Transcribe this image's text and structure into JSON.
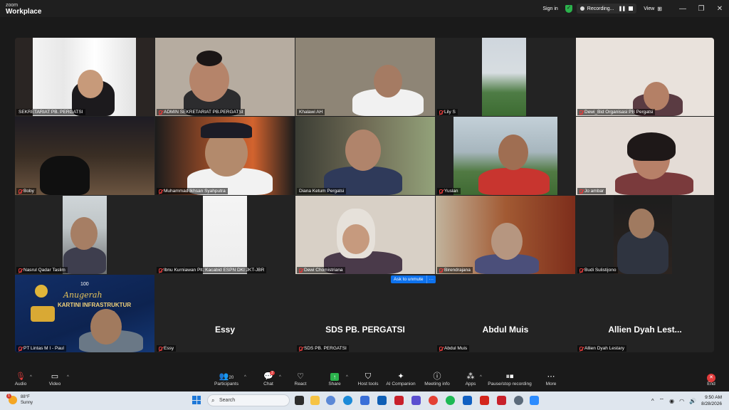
{
  "window": {
    "logo_top": "zoom",
    "logo_bottom": "Workplace",
    "sign_in": "Sign in",
    "recording_label": "Recording...",
    "view_label": "View"
  },
  "participants": [
    {
      "name": "SEKRETARIAT PB. PERGATSI",
      "muted": false
    },
    {
      "name": "ADMIN SEKRETARIAT PB.PERGATSI",
      "muted": true
    },
    {
      "name": "Khalawi AH",
      "muted": false
    },
    {
      "name": "Lily S",
      "muted": true
    },
    {
      "name": "Dewi_Bid Organisasi PB Pergatsi",
      "muted": true
    },
    {
      "name": "Boby",
      "muted": true
    },
    {
      "name": "Muhammad Ikhsan Syahputra",
      "muted": true
    },
    {
      "name": "Diana Ketum Pergatsi",
      "muted": false
    },
    {
      "name": "Yuslan",
      "muted": true
    },
    {
      "name": "Jo ambar",
      "muted": true
    },
    {
      "name": "Nasrul Qadar Taslim",
      "muted": true
    },
    {
      "name": "Ibnu Kurniawan Plt. Kacabid ESPN DKI JKT-JBR",
      "muted": true
    },
    {
      "name": "Dewi Chomistriana",
      "muted": true
    },
    {
      "name": "Birendrajana",
      "muted": true
    },
    {
      "name": "Budi Sulistijono",
      "muted": true
    },
    {
      "name": "PT Lintas M I - Paul",
      "muted": true
    },
    {
      "name": "Essy",
      "muted": true,
      "display": "Essy"
    },
    {
      "name": "SDS PB. PERGATSI",
      "muted": true,
      "display": "SDS PB. PERGATSI"
    },
    {
      "name": "Abdul Muis",
      "muted": true,
      "display": "Abdul Muis"
    },
    {
      "name": "Allien Dyah Lestary",
      "muted": true,
      "display": "Allien Dyah Lest..."
    }
  ],
  "banner": {
    "title1": "Anugerah",
    "title2": "KARTINI INFRASTRUKTUR",
    "year": "20",
    "logo_num": "100"
  },
  "ask_to_unmute": "Ask to unmute",
  "ask_more": "···",
  "toolbar": {
    "audio": "Audio",
    "video": "Video",
    "participants": "Participants",
    "participants_count": "20",
    "chat": "Chat",
    "chat_badge": "2",
    "react": "React",
    "share": "Share",
    "host_tools": "Host tools",
    "ai_companion": "AI Companion",
    "meeting_info": "Meeting info",
    "apps": "Apps",
    "pause_stop": "Pause/stop recording",
    "more": "More",
    "end": "End"
  },
  "taskbar": {
    "temp": "88°F",
    "condition": "Sunny",
    "weather_badge": "1",
    "search": "Search",
    "time": "9:50 AM",
    "date": "8/28/2026"
  },
  "colors": {
    "active_speaker": "#3ebc5a",
    "muted": "#e23b3b",
    "share": "#2bb24c",
    "unmute_button": "#0e72ed"
  }
}
